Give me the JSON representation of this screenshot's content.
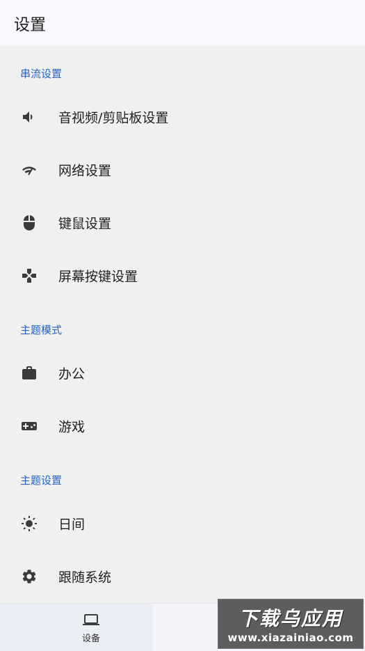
{
  "app_bar": {
    "title": "设置"
  },
  "sections": [
    {
      "header": "串流设置",
      "items": [
        {
          "label": "音视频/剪贴板设置",
          "icon": "volume-icon"
        },
        {
          "label": "网络设置",
          "icon": "wifi-signal-icon"
        },
        {
          "label": "键鼠设置",
          "icon": "mouse-icon"
        },
        {
          "label": "屏幕按键设置",
          "icon": "gamepad-icon"
        }
      ]
    },
    {
      "header": "主题模式",
      "items": [
        {
          "label": "办公",
          "icon": "briefcase-icon"
        },
        {
          "label": "游戏",
          "icon": "game-controller-icon"
        }
      ]
    },
    {
      "header": "主题设置",
      "items": [
        {
          "label": "日间",
          "icon": "sun-icon"
        },
        {
          "label": "跟随系统",
          "icon": "gear-icon"
        }
      ]
    }
  ],
  "bottom_nav": {
    "items": [
      {
        "label": "设备",
        "icon": "laptop-icon"
      }
    ]
  },
  "watermark": {
    "title": "下载乌应用",
    "url": "www.xiazainiao.com"
  },
  "colors": {
    "accent": "#2a63c7",
    "background": "#f0f0f0",
    "app_bar": "#f7f8fc",
    "icon": "#3b3b3b"
  }
}
